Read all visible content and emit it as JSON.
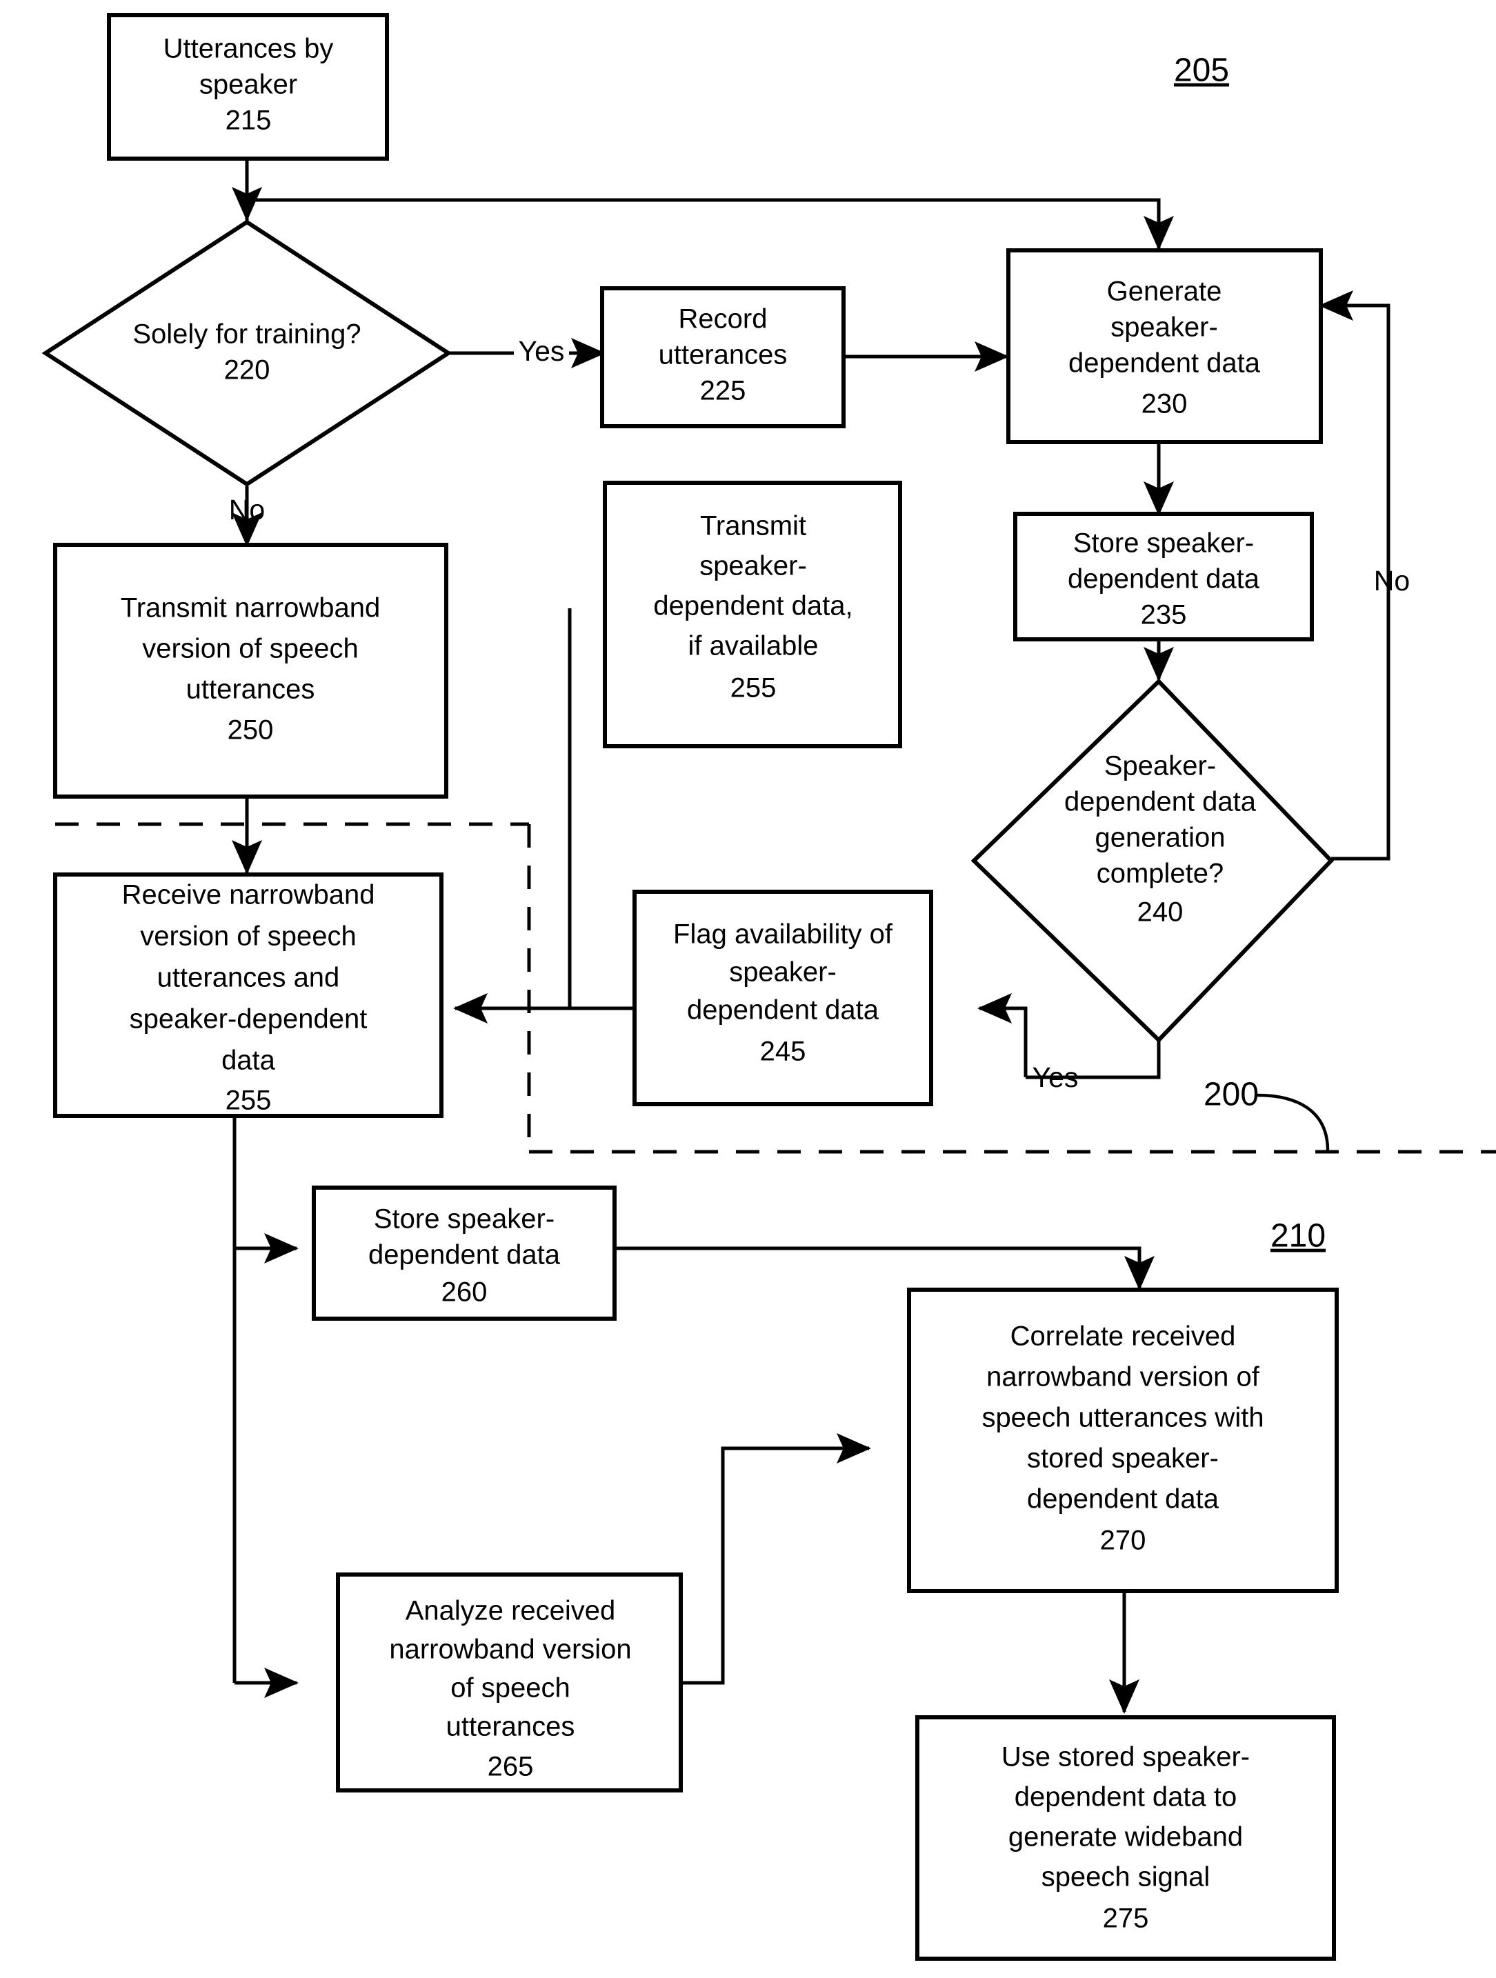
{
  "figure": {
    "title": "Speaker-dependent data flowchart",
    "ref_system": "205",
    "ref_overall": "200",
    "ref_receiver": "210"
  },
  "nodes": {
    "n215": {
      "id": "215",
      "lines": [
        "Utterances by",
        "speaker",
        "215"
      ],
      "shape": "box"
    },
    "n220": {
      "id": "220",
      "lines": [
        "Solely for training?",
        "220"
      ],
      "shape": "diamond"
    },
    "n225": {
      "id": "225",
      "lines": [
        "Record",
        "utterances",
        "225"
      ],
      "shape": "box"
    },
    "n230": {
      "id": "230",
      "lines": [
        "Generate",
        "speaker-",
        "dependent data",
        "230"
      ],
      "shape": "box"
    },
    "n235": {
      "id": "235",
      "lines": [
        "Store speaker-",
        "dependent data",
        "235"
      ],
      "shape": "box"
    },
    "n240": {
      "id": "240",
      "lines": [
        "Speaker-",
        "dependent data",
        "generation",
        "complete?",
        "240"
      ],
      "shape": "diamond"
    },
    "n245": {
      "id": "245",
      "lines": [
        "Flag availability of",
        "speaker-",
        "dependent data",
        "245"
      ],
      "shape": "box"
    },
    "n250": {
      "id": "250",
      "lines": [
        "Transmit narrowband",
        "version of speech",
        "utterances",
        "250"
      ],
      "shape": "box"
    },
    "n255t": {
      "id": "255",
      "lines": [
        "Transmit",
        "speaker-",
        "dependent data,",
        "if available",
        "255"
      ],
      "shape": "box"
    },
    "n255r": {
      "id": "255",
      "lines": [
        "Receive narrowband",
        "version of speech",
        "utterances and",
        "speaker-dependent",
        "data",
        "255"
      ],
      "shape": "box"
    },
    "n260": {
      "id": "260",
      "lines": [
        "Store speaker-",
        "dependent data",
        "260"
      ],
      "shape": "box"
    },
    "n265": {
      "id": "265",
      "lines": [
        "Analyze received",
        "narrowband version",
        "of speech",
        "utterances",
        "265"
      ],
      "shape": "box"
    },
    "n270": {
      "id": "270",
      "lines": [
        "Correlate received",
        "narrowband version of",
        "speech utterances with",
        "stored speaker-",
        "dependent data",
        "270"
      ],
      "shape": "box"
    },
    "n275": {
      "id": "275",
      "lines": [
        "Use stored speaker-",
        "dependent data to",
        "generate wideband",
        "speech signal",
        "275"
      ],
      "shape": "box"
    }
  },
  "edge_labels": {
    "yes_training": "Yes",
    "no_training": "No",
    "no_complete": "No",
    "yes_complete": "Yes"
  },
  "colors": {
    "stroke": "#000000",
    "fill": "#ffffff"
  }
}
